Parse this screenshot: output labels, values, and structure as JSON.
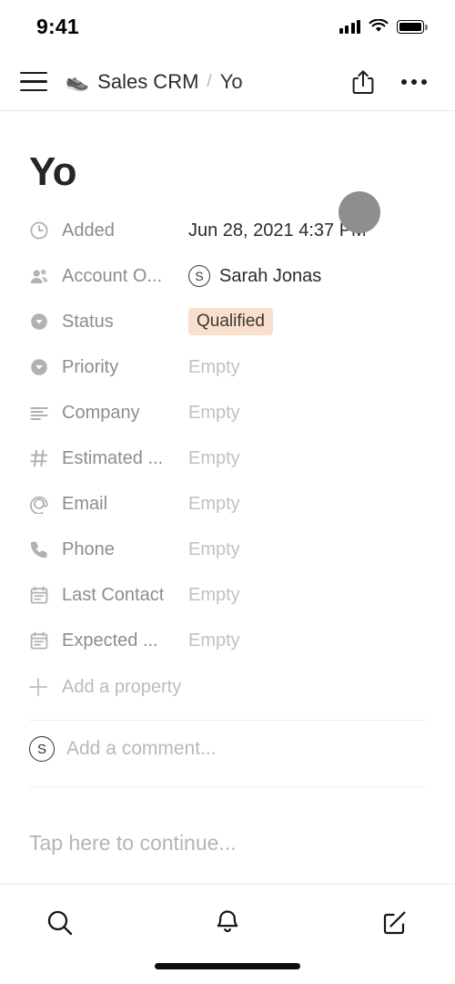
{
  "status_bar": {
    "time": "9:41",
    "cellular_icon": "cellular-signal-icon",
    "wifi_icon": "wifi-icon",
    "battery_icon": "battery-full-icon"
  },
  "nav": {
    "menu_icon": "hamburger-menu-icon",
    "breadcrumb": {
      "database_emoji": "👟",
      "database": "Sales CRM",
      "separator": "/",
      "page": "Yo"
    },
    "share_icon": "share-icon",
    "more_icon": "more-options-icon"
  },
  "page": {
    "title": "Yo",
    "properties": [
      {
        "icon": "clock-icon",
        "label": "Added",
        "value": "Jun 28, 2021 4:37 PM",
        "type": "date",
        "empty": false
      },
      {
        "icon": "people-icon",
        "label": "Account O...",
        "value": "Sarah Jonas",
        "type": "person",
        "empty": false,
        "avatar_initial": "S"
      },
      {
        "icon": "select-icon",
        "label": "Status",
        "value": "Qualified",
        "type": "badge",
        "empty": false,
        "badge_color": "#fadfcd"
      },
      {
        "icon": "select-icon",
        "label": "Priority",
        "value": "Empty",
        "type": "select",
        "empty": true
      },
      {
        "icon": "text-icon",
        "label": "Company",
        "value": "Empty",
        "type": "text",
        "empty": true
      },
      {
        "icon": "number-icon",
        "label": "Estimated ...",
        "value": "Empty",
        "type": "number",
        "empty": true
      },
      {
        "icon": "email-icon",
        "label": "Email",
        "value": "Empty",
        "type": "email",
        "empty": true
      },
      {
        "icon": "phone-icon",
        "label": "Phone",
        "value": "Empty",
        "type": "phone",
        "empty": true
      },
      {
        "icon": "calendar-icon",
        "label": "Last Contact",
        "value": "Empty",
        "type": "date",
        "empty": true
      },
      {
        "icon": "calendar-icon",
        "label": "Expected ...",
        "value": "Empty",
        "type": "date",
        "empty": true
      }
    ],
    "add_property_label": "Add a property",
    "add_property_icon": "plus-icon",
    "comment": {
      "avatar_initial": "S",
      "placeholder": "Add a comment..."
    },
    "body_placeholder": "Tap here to continue..."
  },
  "tab_bar": {
    "tabs": [
      {
        "icon": "search-icon",
        "name": "search"
      },
      {
        "icon": "bell-icon",
        "name": "notifications"
      },
      {
        "icon": "compose-icon",
        "name": "compose"
      }
    ]
  }
}
